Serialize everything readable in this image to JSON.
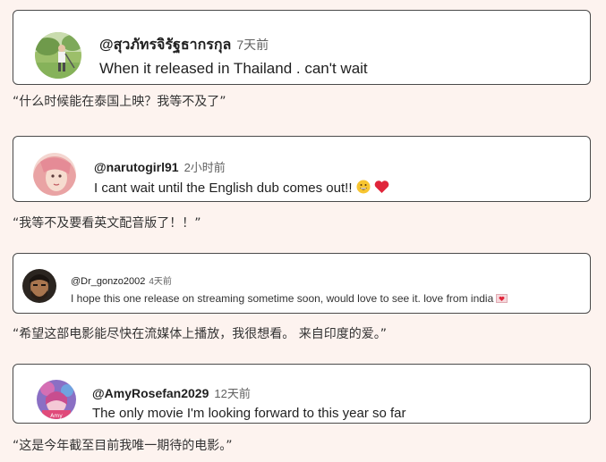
{
  "comments": [
    {
      "handle": "@สุวภัทรจิรัฐธากรกุล",
      "time": "7天前",
      "text": "When it released in Thailand . can't wait",
      "translation": "“什么时候能在泰国上映？我等不及了”",
      "avatar_icon": "golf-player-photo-icon"
    },
    {
      "handle": "@narutogirl91",
      "time": "2小时前",
      "text": "I cant wait until the English dub comes out!!",
      "translation": "“我等不及要看英文配音版了！！”",
      "avatar_icon": "pink-hair-girl-photo-icon",
      "emojis": [
        "grinning-face-emoji",
        "red-heart-emoji"
      ]
    },
    {
      "handle": "@Dr_gonzo2002",
      "time": "4天前",
      "text": "I hope this one release on streaming sometime soon, would love to see it. love from india",
      "translation": "“希望这部电影能尽快在流媒体上播放，我很想看。 来自印度的爱。”",
      "avatar_icon": "bearded-man-photo-icon",
      "emojis": [
        "heart-letter-emoji"
      ]
    },
    {
      "handle": "@AmyRosefan2029",
      "time": "12天前",
      "text": "The only movie I'm looking forward to this year so far",
      "translation": "“这是今年截至目前我唯一期待的电影。”",
      "avatar_icon": "anime-girl-avatar-icon"
    }
  ],
  "colors": {
    "page_background": "#fdf3ef",
    "card_border": "#4a4a4a",
    "timestamp": "#606060",
    "heart": "#e0253a"
  }
}
